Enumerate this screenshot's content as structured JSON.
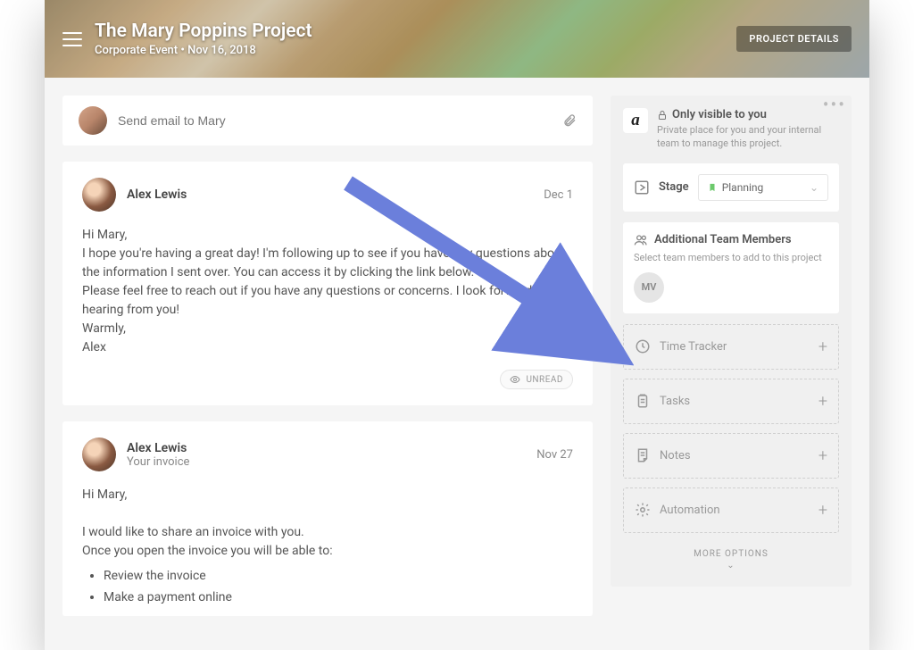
{
  "header": {
    "title": "The Mary Poppins Project",
    "subtitle": "Corporate Event • Nov 16, 2018",
    "details_button": "PROJECT DETAILS"
  },
  "compose": {
    "placeholder": "Send email to Mary"
  },
  "messages": [
    {
      "author": "Alex Lewis",
      "date": "Dec 1",
      "body": "Hi Mary,\nI hope you're having a great day! I'm following up to see if you have any questions about the information I sent over. You can access it by clicking the link below.\nPlease feel free to reach out if you have any questions or concerns. I look forward to hearing from you!\nWarmly,\nAlex",
      "status": "UNREAD"
    },
    {
      "author": "Alex Lewis",
      "subject": "Your invoice",
      "date": "Nov 27",
      "body": "Hi Mary,\n\nI would like to share an invoice with you.\nOnce you open the invoice you will be able to:",
      "bullets": [
        "Review the invoice",
        "Make a payment online"
      ]
    }
  ],
  "sidebar": {
    "logo": "a",
    "visibility_title": "Only visible to you",
    "visibility_desc": "Private place for you and your internal team to manage this project.",
    "stage_label": "Stage",
    "stage_value": "Planning",
    "team_title": "Additional Team Members",
    "team_desc": "Select team members to add to this project",
    "member_initials": "MV",
    "widgets": [
      {
        "icon": "clock",
        "label": "Time Tracker"
      },
      {
        "icon": "clipboard",
        "label": "Tasks"
      },
      {
        "icon": "note",
        "label": "Notes"
      },
      {
        "icon": "gear",
        "label": "Automation"
      }
    ],
    "more_options": "MORE OPTIONS"
  }
}
